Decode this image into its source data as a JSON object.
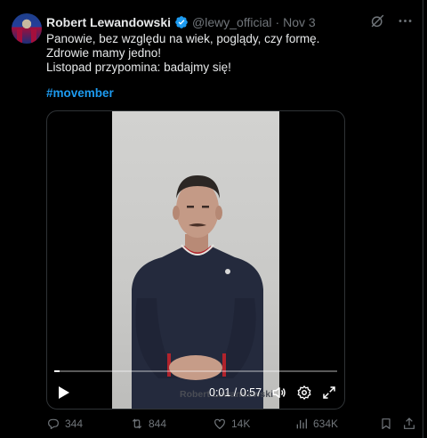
{
  "author": {
    "name": "Robert Lewandowski",
    "handle": "@lewy_official",
    "separator": "·",
    "date": "Nov 3"
  },
  "post": {
    "lines": [
      "Panowie, bez względu na wiek, poglądy, czy formę.",
      "Zdrowie mamy jedno!",
      "Listopad przypomina: badajmy się!"
    ],
    "hashtag": "#movember"
  },
  "video": {
    "watermark": "Robert Lewandowski",
    "time": "0:01 / 0:57",
    "progress": 0.02,
    "controls": [
      "play-icon",
      "volume-icon",
      "settings-icon",
      "fullscreen-icon"
    ]
  },
  "actions": {
    "replies": "344",
    "reposts": "844",
    "likes": "14K",
    "views": "634K"
  },
  "colors": {
    "background": "#000000",
    "text": "#e7e9ea",
    "muted": "#71767b",
    "accent": "#1d9bf0"
  }
}
